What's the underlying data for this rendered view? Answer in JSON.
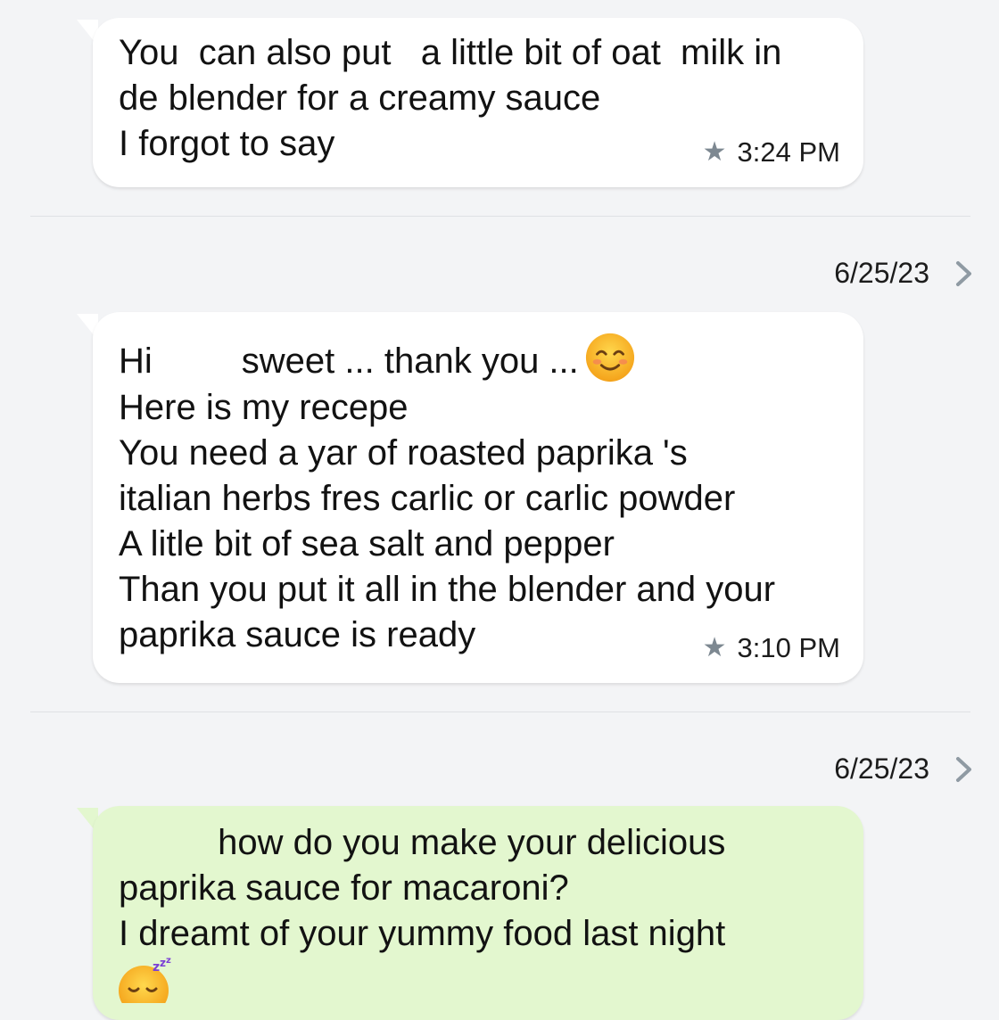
{
  "messages": [
    {
      "lines": [
        "You  can also put   a little bit of oat  milk in",
        "de blender for a creamy sauce",
        "I forgot to say"
      ],
      "time": "3:24 PM",
      "starred": true,
      "star_icon": "star-icon"
    },
    {
      "first_line": "Hi         sweet ... thank you ...",
      "emoji": "smiling-face-icon",
      "lines": [
        "Here is my recepe",
        "You need a yar of roasted paprika 's",
        "italian herbs fres carlic or carlic powder",
        "A litle bit of sea salt and pepper",
        "Than you put it all in the blender and your",
        "paprika sauce is ready"
      ],
      "time": "3:10 PM",
      "starred": true,
      "star_icon": "star-icon"
    },
    {
      "lines": [
        "          how do you make your delicious",
        "paprika sauce for macaroni?",
        "I dreamt of your yummy food last night"
      ],
      "emoji": "sleeping-face-icon"
    }
  ],
  "dates": [
    "6/25/23",
    "6/25/23"
  ],
  "colors": {
    "background": "#f3f4f6",
    "incoming_bubble": "#ffffff",
    "outgoing_bubble": "#e3f7cf",
    "star": "#7d8891",
    "chevron": "#8f9aa3"
  },
  "icons": {
    "chevron": "chevron-right-icon"
  }
}
